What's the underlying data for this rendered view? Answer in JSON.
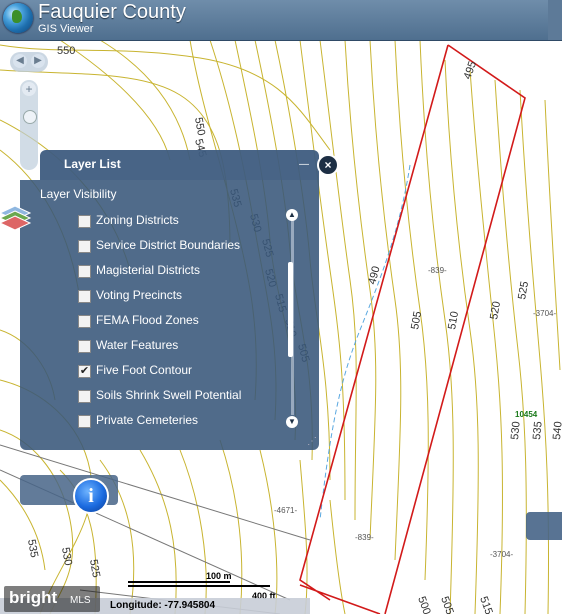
{
  "app": {
    "title": "Fauquier County",
    "subtitle": "GIS Viewer"
  },
  "map": {
    "contour_labels": [
      "550",
      "550",
      "545",
      "535",
      "530",
      "525",
      "520",
      "515",
      "510",
      "505",
      "495",
      "490",
      "505",
      "510",
      "520",
      "525",
      "530",
      "535",
      "540",
      "535",
      "530",
      "525",
      "500",
      "505",
      "515"
    ],
    "parcel_labels": [
      "-839-",
      "-3704-",
      "-4671-",
      "-839-",
      "-3704-",
      "10454"
    ]
  },
  "layer_list": {
    "title": "Layer List",
    "minimize_label": "—",
    "close_label": "×",
    "visibility_label": "Layer Visibility",
    "layers": [
      {
        "label": "Zoning Districts",
        "checked": false
      },
      {
        "label": "Service District Boundaries",
        "checked": false
      },
      {
        "label": "Magisterial Districts",
        "checked": false
      },
      {
        "label": "Voting Precincts",
        "checked": false
      },
      {
        "label": "FEMA Flood Zones",
        "checked": false
      },
      {
        "label": "Water Features",
        "checked": false
      },
      {
        "label": "Five Foot Contour",
        "checked": true
      },
      {
        "label": "Soils Shrink Swell Potential",
        "checked": false
      },
      {
        "label": "Private Cemeteries",
        "checked": false
      }
    ]
  },
  "info_button": {
    "label": "i"
  },
  "scalebar": {
    "metric_label": "100 m",
    "imperial_label": "400 ft"
  },
  "coordinates": {
    "longitude_text": "Longitude: -77.945804"
  },
  "watermark": {
    "brand": "bright",
    "suffix": "MLS"
  },
  "colors": {
    "contour": "#c8b430",
    "parcel": "#d21a1a",
    "stream": "#5aa8e0",
    "header": "#5b7b9b"
  }
}
